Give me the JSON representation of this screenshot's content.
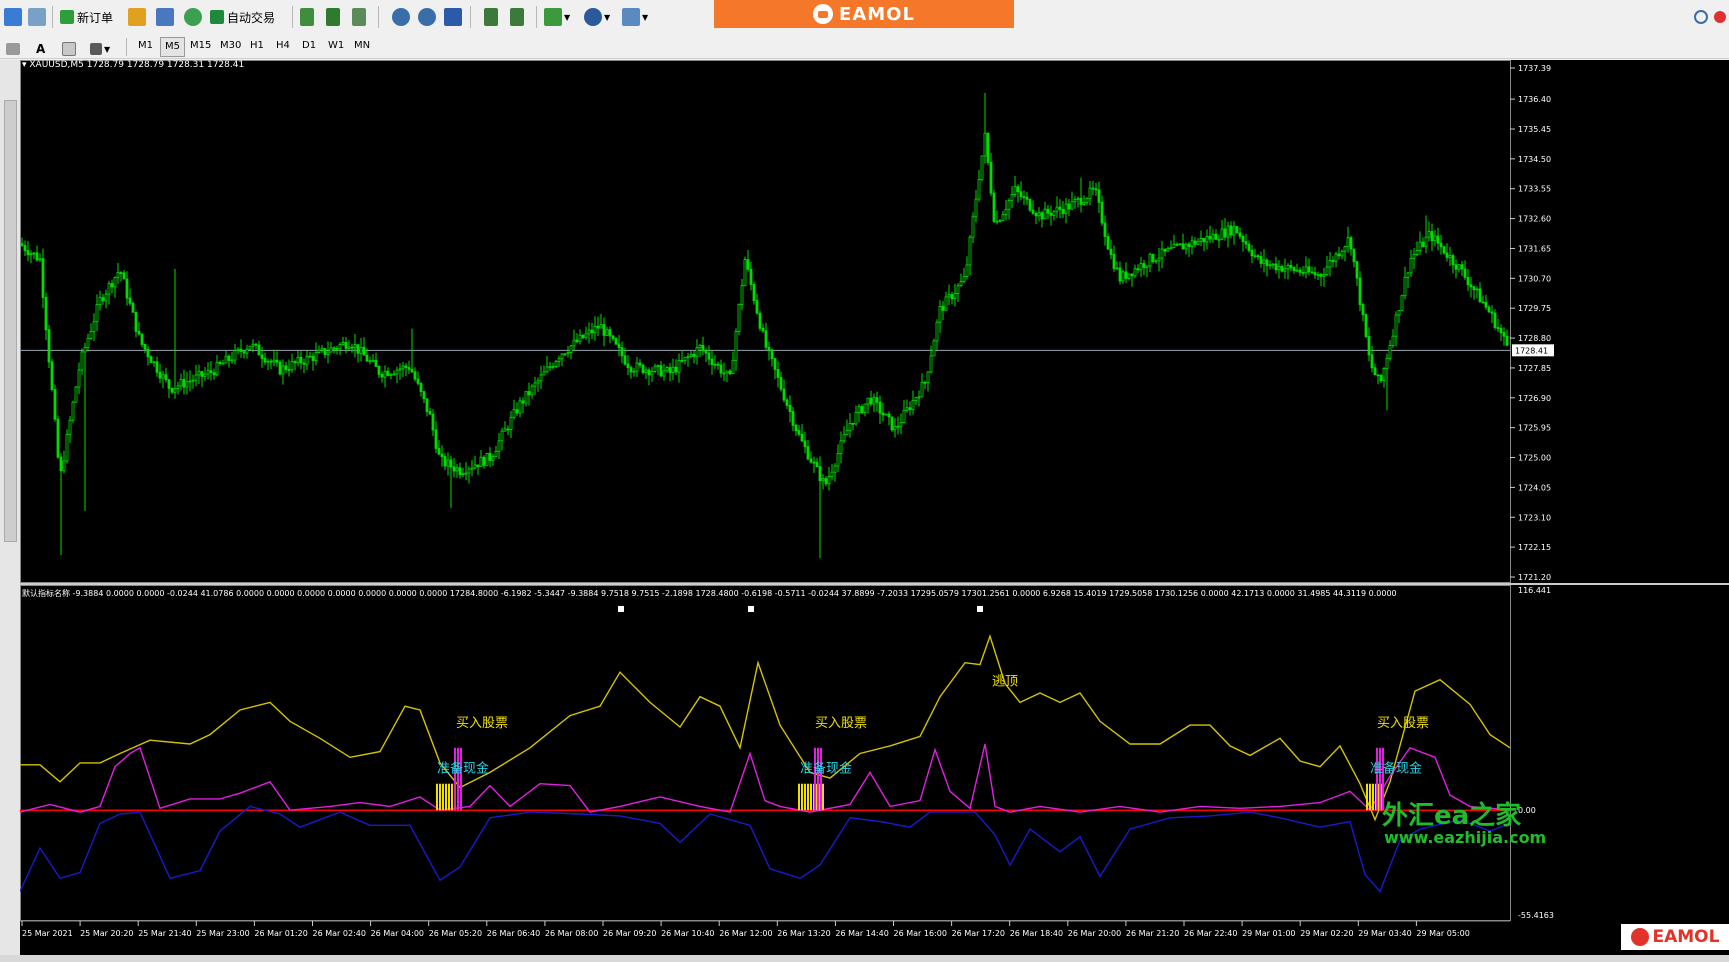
{
  "toolbar": {
    "new_order_label": "新订单",
    "auto_trade_label": "自动交易"
  },
  "timeframes": [
    "M1",
    "M5",
    "M15",
    "M30",
    "H1",
    "H4",
    "D1",
    "W1",
    "MN"
  ],
  "active_timeframe": "M5",
  "brand": {
    "name": "EAMOL"
  },
  "symbol_info": "XAUUSD,M5  1728.79 1728.79 1728.31 1728.41",
  "indicator_info": "默认指标名称 -9.3884 0.0000 0.0000 -0.0244 41.0786 0.0000 0.0000 0.0000 0.0000 0.0000 0.0000 0.0000 17284.8000 -6.1982 -5.3447 -9.3884 9.7518 9.7515 -2.1898 1728.4800 -0.6198 -0.5711 -0.0244 37.8899 -7.2033 17295.0579 17301.2561 0.0000 6.9268 15.4019 1729.5058 1730.1256 0.0000 42.1713 0.0000 31.4985 44.3119 0.0000",
  "price_axis": [
    "1737.39",
    "1736.40",
    "1735.45",
    "1734.50",
    "1733.55",
    "1732.60",
    "1731.65",
    "1730.70",
    "1729.75",
    "1728.80",
    "1727.85",
    "1726.90",
    "1725.95",
    "1725.00",
    "1724.05",
    "1723.10",
    "1722.15",
    "1721.20"
  ],
  "current_price": "1728.41",
  "indicator_axis": [
    "116.441",
    "0.00",
    "-55.4163"
  ],
  "time_axis": [
    "25 Mar 2021",
    "25 Mar 20:20",
    "25 Mar 21:40",
    "25 Mar 23:00",
    "26 Mar 01:20",
    "26 Mar 02:40",
    "26 Mar 04:00",
    "26 Mar 05:20",
    "26 Mar 06:40",
    "26 Mar 08:00",
    "26 Mar 09:20",
    "26 Mar 10:40",
    "26 Mar 12:00",
    "26 Mar 13:20",
    "26 Mar 14:40",
    "26 Mar 16:00",
    "26 Mar 17:20",
    "26 Mar 18:40",
    "26 Mar 20:00",
    "26 Mar 21:20",
    "26 Mar 22:40",
    "29 Mar 01:00",
    "29 Mar 02:20",
    "29 Mar 03:40",
    "29 Mar 05:00"
  ],
  "signals": {
    "buy_label": "买入股票",
    "cash_label": "准备现金",
    "escape_label": "逃顶"
  },
  "watermark": {
    "main": "外汇ea之家",
    "url": "www.eazhijia.com",
    "brand": "EAMOL"
  },
  "colors": {
    "bull_candle": "#00dd00",
    "yellow_line": "#d4c400",
    "magenta_line": "#e020e0",
    "blue_line": "#1a1acc",
    "zero_line": "#ff0000",
    "current_price_line": "#9aa4b0"
  }
}
